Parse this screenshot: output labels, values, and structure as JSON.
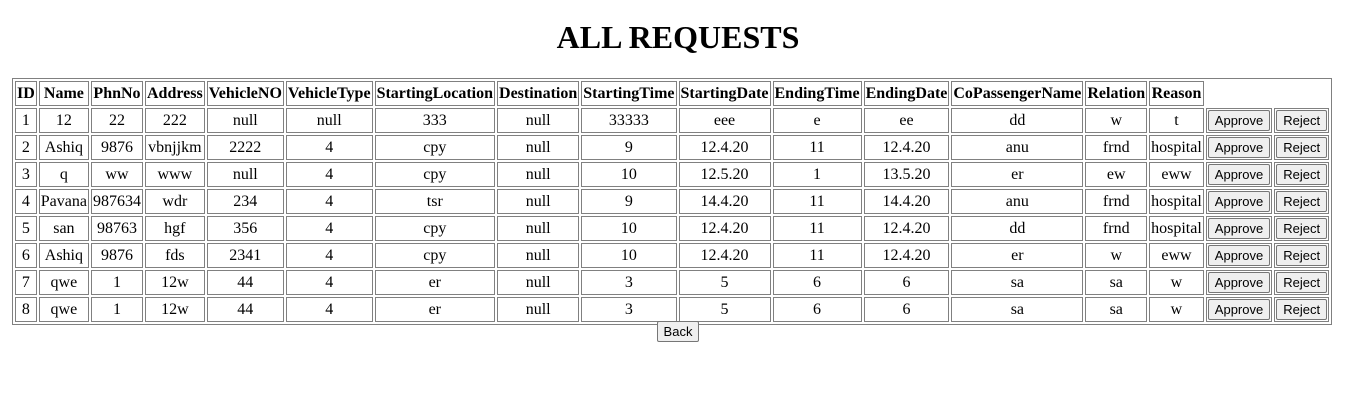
{
  "page": {
    "title": "ALL REQUESTS",
    "back_label": "Back"
  },
  "table": {
    "columns": [
      "ID",
      "Name",
      "PhnNo",
      "Address",
      "VehicleNO",
      "VehicleType",
      "StartingLocation",
      "Destination",
      "StartingTime",
      "StartingDate",
      "EndingTime",
      "EndingDate",
      "CoPassengerName",
      "Relation",
      "Reason"
    ],
    "approve_label": "Approve",
    "reject_label": "Reject",
    "rows": [
      [
        "1",
        "12",
        "22",
        "222",
        "null",
        "null",
        "333",
        "null",
        "33333",
        "eee",
        "e",
        "ee",
        "dd",
        "w",
        "t"
      ],
      [
        "2",
        "Ashiq",
        "9876",
        "vbnjjkm",
        "2222",
        "4",
        "cpy",
        "null",
        "9",
        "12.4.20",
        "11",
        "12.4.20",
        "anu",
        "frnd",
        "hospital"
      ],
      [
        "3",
        "q",
        "ww",
        "www",
        "null",
        "4",
        "cpy",
        "null",
        "10",
        "12.5.20",
        "1",
        "13.5.20",
        "er",
        "ew",
        "eww"
      ],
      [
        "4",
        "Pavana",
        "987634",
        "wdr",
        "234",
        "4",
        "tsr",
        "null",
        "9",
        "14.4.20",
        "11",
        "14.4.20",
        "anu",
        "frnd",
        "hospital"
      ],
      [
        "5",
        "san",
        "98763",
        "hgf",
        "356",
        "4",
        "cpy",
        "null",
        "10",
        "12.4.20",
        "11",
        "12.4.20",
        "dd",
        "frnd",
        "hospital"
      ],
      [
        "6",
        "Ashiq",
        "9876",
        "fds",
        "2341",
        "4",
        "cpy",
        "null",
        "10",
        "12.4.20",
        "11",
        "12.4.20",
        "er",
        "w",
        "eww"
      ],
      [
        "7",
        "qwe",
        "1",
        "12w",
        "44",
        "4",
        "er",
        "null",
        "3",
        "5",
        "6",
        "6",
        "sa",
        "sa",
        "w"
      ],
      [
        "8",
        "qwe",
        "1",
        "12w",
        "44",
        "4",
        "er",
        "null",
        "3",
        "5",
        "6",
        "6",
        "sa",
        "sa",
        "w"
      ]
    ]
  }
}
